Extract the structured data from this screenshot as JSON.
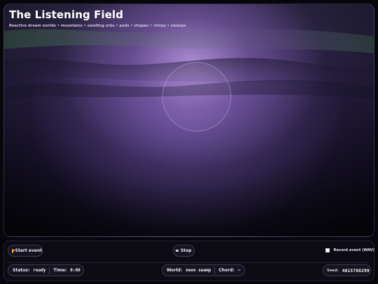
{
  "header": {
    "title": "The Listening Field",
    "subtitle": "Reactive dream worlds • mountains • swelling orbs • pads • shapes • chirps • sweeps"
  },
  "controls": {
    "start_label": "Start event",
    "stop_label": "Stop",
    "record_label": "Record event (WAV)",
    "record_checked": false
  },
  "status_bar": {
    "status_label": "Status:",
    "status_value": "ready",
    "time_label": "Time:",
    "time_value": "0:00",
    "world_label": "World:",
    "world_value": "neon swamp",
    "chord_label": "Chord:",
    "chord_value": "—",
    "seed_label": "Seed:",
    "seed_value": "4015788299"
  },
  "icons": {
    "start": "play-icon",
    "stop": "stop-icon"
  },
  "colors": {
    "accent": "#f0a23a",
    "glow": "#c4a0eb",
    "background": "#07060d"
  }
}
